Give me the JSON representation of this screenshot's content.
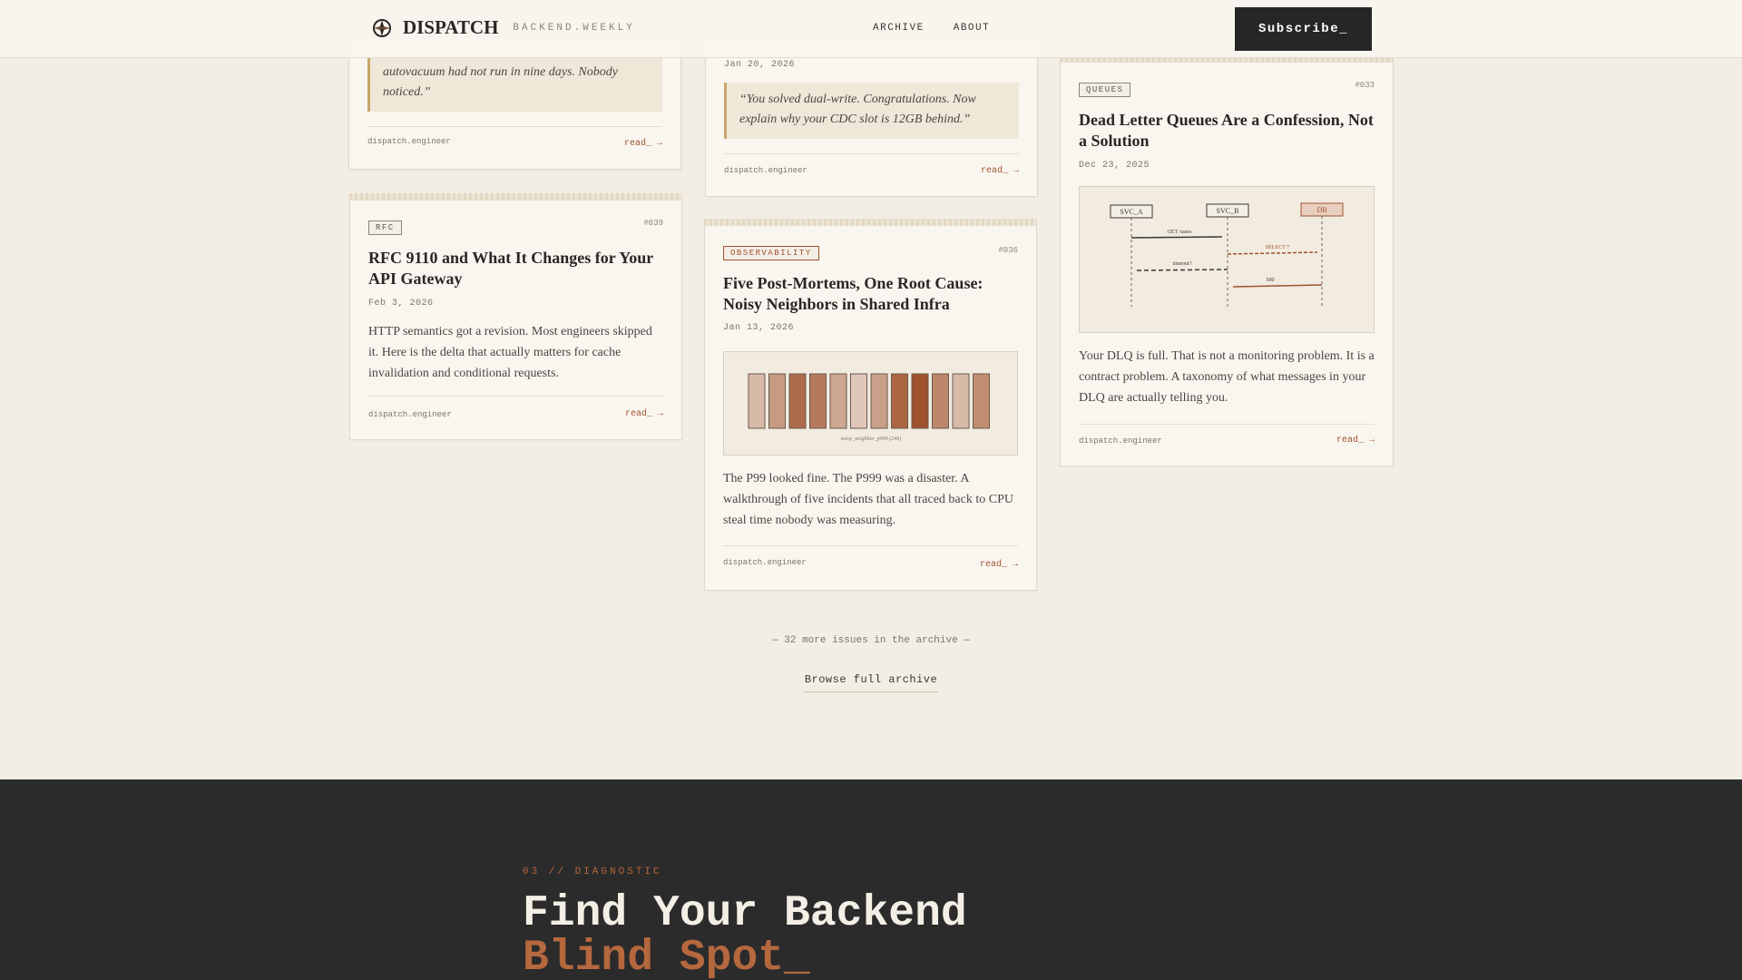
{
  "header": {
    "brand": "DISPATCH",
    "brand_sub": "BACKEND.WEEKLY",
    "nav": [
      "ARCHIVE",
      "ABOUT"
    ],
    "subscribe": "Subscribe_"
  },
  "cards": {
    "c1": {
      "quote": "autovacuum had not run in nine days. Nobody noticed.”",
      "domain": "dispatch.engineer",
      "read": "read_ →"
    },
    "c2": {
      "date": "Jan 20, 2026",
      "quote": "“You solved dual-write. Congratulations. Now explain why your CDC slot is 12GB behind.”",
      "domain": "dispatch.engineer",
      "read": "read_ →"
    },
    "c3": {
      "tag": "QUEUES",
      "issue": "#033",
      "title": "Dead Letter Queues Are a Confession, Not a Solution",
      "date": "Dec 23, 2025",
      "figure": {
        "actors": [
          "SVC_A",
          "SVC_B",
          "DB"
        ],
        "messages": [
          "GET /users",
          "SELECT *",
          "timeout?",
          "500"
        ]
      },
      "excerpt": "Your DLQ is full. That is not a monitoring problem. It is a contract problem. A taxonomy of what messages in your DLQ are actually telling you.",
      "domain": "dispatch.engineer",
      "read": "read_ →"
    },
    "c4": {
      "tag": "RFC",
      "issue": "#039",
      "title": "RFC 9110 and What It Changes for Your API Gateway",
      "date": "Feb 3, 2026",
      "excerpt": "HTTP semantics got a revision. Most engineers skipped it. Here is the delta that actually matters for cache invalidation and conditional requests.",
      "domain": "dispatch.engineer",
      "read": "read_ →"
    },
    "c5": {
      "tag": "OBSERVABILITY",
      "issue": "#036",
      "title": "Five Post-Mortems, One Root Cause: Noisy Neighbors in Shared Infra",
      "date": "Jan 13, 2026",
      "figure_caption": "noisy_neighbor_p999 (24h)",
      "bar_levels": [
        0.2,
        0.45,
        0.8,
        0.7,
        0.35,
        0.1,
        0.4,
        0.85,
        1.0,
        0.6,
        0.2,
        0.55
      ],
      "excerpt": "The P99 looked fine. The P999 was a disaster. A walkthrough of five incidents that all traced back to CPU steal time nobody was measuring.",
      "domain": "dispatch.engineer",
      "read": "read_ →"
    }
  },
  "archive": {
    "more": "— 32 more issues in the archive —",
    "browse": "Browse full archive"
  },
  "dark": {
    "eyebrow": "03 // DIAGNOSTIC",
    "title_line1": "Find Your Backend",
    "title_line2": "Blind Spot_"
  },
  "colors": {
    "accent": "#a0522d",
    "background": "#f3eee4",
    "dark": "#2b2b2b"
  }
}
